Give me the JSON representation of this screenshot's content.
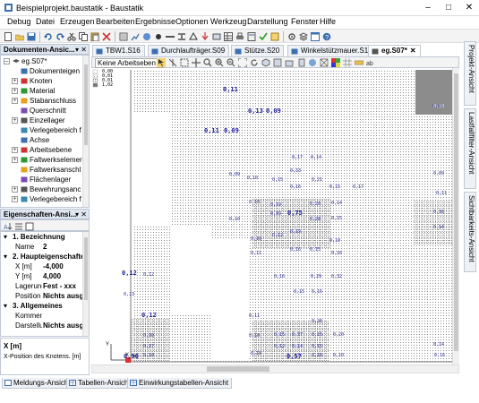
{
  "window": {
    "title": "Beispielprojekt.baustatik - Baustatik",
    "minimize": "–",
    "maximize": "□",
    "close": "✕"
  },
  "menu": [
    "Debug",
    "Datei",
    "Erzeugen",
    "Bearbeiten",
    "Ergebnisse",
    "Optionen",
    "Werkzeug",
    "Darstellung",
    "Fenster",
    "Hilfe"
  ],
  "doc_panel": {
    "title": "Dokumenten-Ansic...",
    "pin": "▾ ✕",
    "root": "eg.S07*",
    "items": [
      {
        "label": "Dokumenteigen",
        "exp": ""
      },
      {
        "label": "Knoten",
        "exp": "+"
      },
      {
        "label": "Material",
        "exp": "+"
      },
      {
        "label": "Stabanschluss",
        "exp": "+"
      },
      {
        "label": "Querschnitt",
        "exp": ""
      },
      {
        "label": "Einzellager",
        "exp": "+"
      },
      {
        "label": "Verlegebereich f",
        "exp": ""
      },
      {
        "label": "Achse",
        "exp": ""
      },
      {
        "label": "Arbeitsebene",
        "exp": "+"
      },
      {
        "label": "Faltwerkselemer",
        "exp": "+"
      },
      {
        "label": "Faltwerksanschl",
        "exp": ""
      },
      {
        "label": "Flächenlager",
        "exp": ""
      },
      {
        "label": "Bewehrungsanc",
        "exp": "+"
      },
      {
        "label": "Verlegebereich f",
        "exp": "+"
      }
    ]
  },
  "prop_panel": {
    "title": "Eigenschaften-Ansi...",
    "pin": "▾ ✕",
    "rows": [
      {
        "kind": "section",
        "label": "1. Bezeichnung",
        "value": ""
      },
      {
        "kind": "row",
        "label": "Name",
        "value": "2"
      },
      {
        "kind": "section",
        "label": "2. Haupteigenschaften",
        "value": ""
      },
      {
        "kind": "row",
        "label": "X [m]",
        "value": "-4,000"
      },
      {
        "kind": "row",
        "label": "Y [m]",
        "value": "4,000"
      },
      {
        "kind": "row",
        "label": "Lagerung",
        "value": "Fest - xxx"
      },
      {
        "kind": "row",
        "label": "Position",
        "value": "Nichts ausgewä"
      },
      {
        "kind": "section",
        "label": "3. Allgemeines",
        "value": ""
      },
      {
        "kind": "row",
        "label": "Kommen",
        "value": ""
      },
      {
        "kind": "row",
        "label": "Darstellu",
        "value": "Nichts ausgewä"
      }
    ],
    "desc_title": "X [m]",
    "desc_text": "X-Position des Knotens. [m]"
  },
  "tabs": [
    {
      "label": "TBW1.S16",
      "active": false
    },
    {
      "label": "Durchlaufträger.S09",
      "active": false
    },
    {
      "label": "Stütze.S20",
      "active": false
    },
    {
      "label": "Winkelstützmauer.S15",
      "active": false
    },
    {
      "label": "eg.S07*",
      "active": true
    }
  ],
  "tab_close": "✕",
  "view_toolbar": {
    "workplane_select": "Keine Arbeitseben ▾"
  },
  "legend": [
    "0,00",
    "0,01",
    "0,01",
    "1,02"
  ],
  "colors": {
    "accent": "#3a6fb0",
    "label_blue": "#1c1c9c",
    "axis_red": "#e03030"
  },
  "canvas_values": {
    "small": [
      "0,10",
      "0,09",
      "0,11",
      "0,17",
      "0,14",
      "0,33",
      "0,15",
      "0,21",
      "0,09",
      "0,10",
      "0,16",
      "0,15",
      "0,17",
      "0,10",
      "0,19",
      "0,26",
      "0,39",
      "0,10",
      "0,28",
      "0,16",
      "0,14",
      "0,19",
      "0,12",
      "0,10",
      "0,10",
      "0,16",
      "0,15",
      "0,16",
      "0,11",
      "0,12",
      "0,16",
      "0,29",
      "0,13",
      "0,32",
      "0,15",
      "0,16",
      "0,20",
      "0,37",
      "0,16",
      "0,10",
      "0,11",
      "0,15",
      "0,20",
      "0,10",
      "0,14",
      "0,15",
      "0,12",
      "0,17",
      "0,10",
      "0,14",
      "0,16",
      "0,10",
      "0,10",
      "0,10",
      "0,14",
      "0,15"
    ],
    "large": [
      "0,11",
      "0,13",
      "0,09",
      "0,11",
      "0,09",
      "0,75",
      "0,12",
      "0,12",
      "0,90",
      "0,57"
    ]
  },
  "side_tabs": [
    "Projekt-Ansicht",
    "Lastfallfilter-Ansicht",
    "Sichtbarkeits-Ansicht"
  ],
  "bottom_tabs": [
    "Meldungs-Ansicht",
    "Tabellen-Ansicht",
    "Einwirkungstabellen-Ansicht"
  ],
  "axis": {
    "x": "X",
    "y": "Y"
  }
}
